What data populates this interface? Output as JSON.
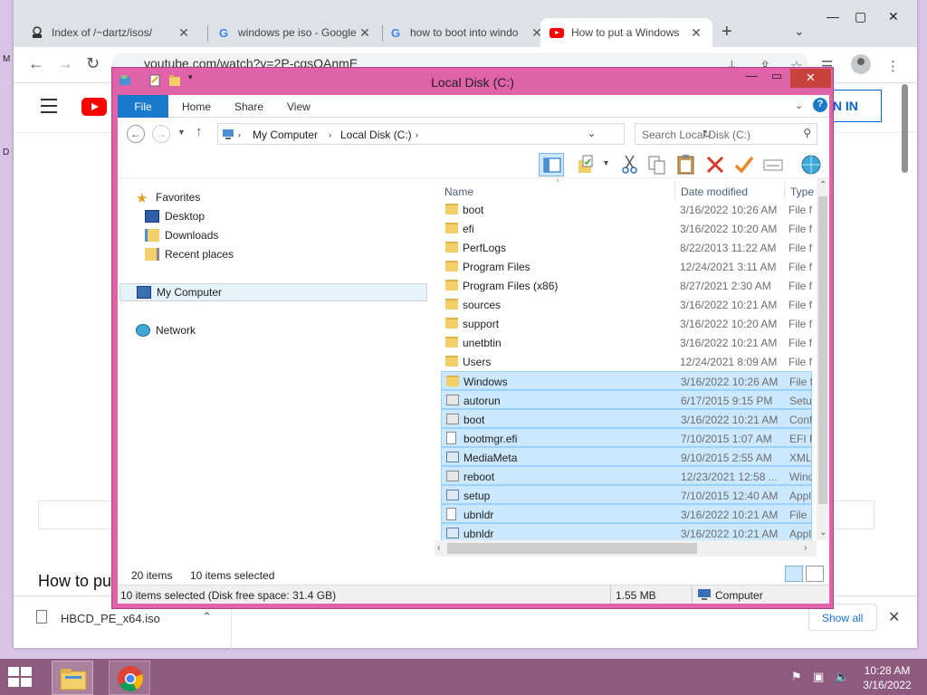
{
  "browser": {
    "tabs": [
      {
        "title": "Index of /~dartz/isos/",
        "favicon": "server-icon",
        "active": false
      },
      {
        "title": "windows pe iso - Google",
        "favicon": "google-icon",
        "active": false
      },
      {
        "title": "how to boot into windo",
        "favicon": "google-icon",
        "active": false
      },
      {
        "title": "How to put a Windows",
        "favicon": "youtube-icon",
        "active": true
      }
    ],
    "new_tab_symbol": "+",
    "url": "youtube.com/watch?v=2P-cqsOAnmE",
    "signin_label": "GN IN",
    "video_title_fragment": "How to pu",
    "download": {
      "filename": "HBCD_PE_x64.iso",
      "show_all_label": "Show all"
    },
    "left_edge_letters": [
      "M",
      "D"
    ]
  },
  "explorer": {
    "title": "Local Disk (C:)",
    "ribbon_tabs": [
      "File",
      "Home",
      "Share",
      "View"
    ],
    "breadcrumb": [
      "My Computer",
      "Local Disk (C:)"
    ],
    "search_placeholder": "Search Local Disk (C:)",
    "nav": {
      "favorites": "Favorites",
      "desktop": "Desktop",
      "downloads": "Downloads",
      "recent": "Recent places",
      "my_computer": "My Computer",
      "network": "Network"
    },
    "columns": [
      "Name",
      "Date modified",
      "Type"
    ],
    "files": [
      {
        "name": "boot",
        "date": "3/16/2022 10:26 AM",
        "type": "File f",
        "icon": "folder",
        "selected": false
      },
      {
        "name": "efi",
        "date": "3/16/2022 10:20 AM",
        "type": "File f",
        "icon": "folder",
        "selected": false
      },
      {
        "name": "PerfLogs",
        "date": "8/22/2013 11:22 AM",
        "type": "File f",
        "icon": "folder",
        "selected": false
      },
      {
        "name": "Program Files",
        "date": "12/24/2021 3:11 AM",
        "type": "File f",
        "icon": "folder",
        "selected": false
      },
      {
        "name": "Program Files (x86)",
        "date": "8/27/2021 2:30 AM",
        "type": "File f",
        "icon": "folder",
        "selected": false
      },
      {
        "name": "sources",
        "date": "3/16/2022 10:21 AM",
        "type": "File f",
        "icon": "folder",
        "selected": false
      },
      {
        "name": "support",
        "date": "3/16/2022 10:20 AM",
        "type": "File f",
        "icon": "folder",
        "selected": false
      },
      {
        "name": "unetbtin",
        "date": "3/16/2022 10:21 AM",
        "type": "File f",
        "icon": "folder",
        "selected": false
      },
      {
        "name": "Users",
        "date": "12/24/2021 8:09 AM",
        "type": "File f",
        "icon": "folder",
        "selected": false
      },
      {
        "name": "Windows",
        "date": "3/16/2022 10:26 AM",
        "type": "File f",
        "icon": "folder",
        "selected": true
      },
      {
        "name": "autorun",
        "date": "6/17/2015 9:15 PM",
        "type": "Setup",
        "icon": "cfg",
        "selected": true
      },
      {
        "name": "boot",
        "date": "3/16/2022 10:21 AM",
        "type": "Confi",
        "icon": "cfg",
        "selected": true
      },
      {
        "name": "bootmgr.efi",
        "date": "7/10/2015 1:07 AM",
        "type": "EFI Fi",
        "icon": "file",
        "selected": true
      },
      {
        "name": "MediaMeta",
        "date": "9/10/2015 2:55 AM",
        "type": "XML",
        "icon": "app",
        "selected": true
      },
      {
        "name": "reboot",
        "date": "12/23/2021 12:58 ...",
        "type": "Wind",
        "icon": "cfg",
        "selected": true
      },
      {
        "name": "setup",
        "date": "7/10/2015 12:40 AM",
        "type": "Appl",
        "icon": "app",
        "selected": true
      },
      {
        "name": "ubnldr",
        "date": "3/16/2022 10:21 AM",
        "type": "File",
        "icon": "file",
        "selected": true
      },
      {
        "name": "ubnldr",
        "date": "3/16/2022 10:21 AM",
        "type": "Appl",
        "icon": "app",
        "selected": true
      }
    ],
    "item_count": "20 items",
    "selected_count": "10 items selected",
    "status": {
      "selection": "10 items selected (Disk free space: 31.4 GB)",
      "size": "1.55 MB",
      "location": "Computer"
    }
  },
  "taskbar": {
    "time": "10:28 AM",
    "date": "3/16/2022"
  },
  "colors": {
    "explorer_frame": "#e062a9",
    "ribbon_file": "#1979ca",
    "selection": "#cce8ff",
    "taskbar": "#8f5a7f",
    "youtube_red": "#ff0000"
  }
}
